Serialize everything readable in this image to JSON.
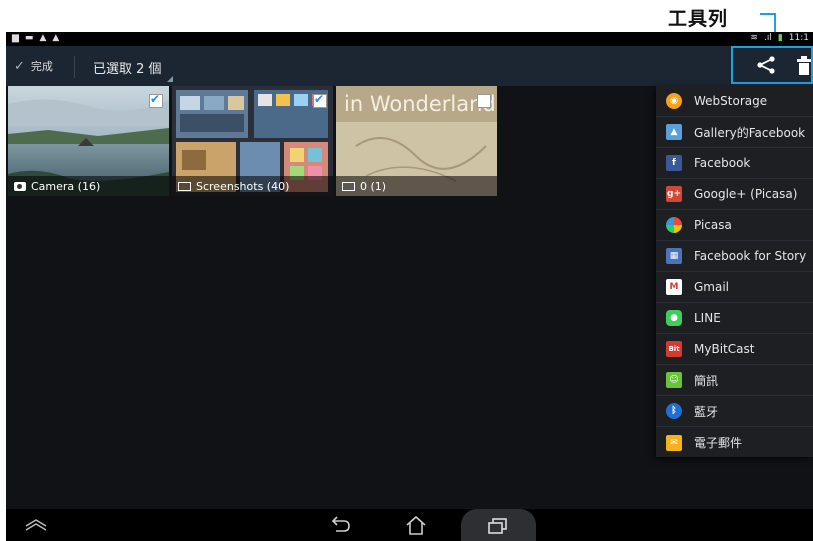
{
  "annotation": {
    "label": "工具列"
  },
  "status_bar": {
    "time": "11:1"
  },
  "action_bar": {
    "done_label": "完成",
    "selection_text": "已選取 2 個"
  },
  "albums": [
    {
      "name": "Camera (16)",
      "checked": true
    },
    {
      "name": "Screenshots (40)",
      "checked": true
    },
    {
      "name": "0 (1)",
      "checked": false,
      "thumb_text": "in Wonderland"
    }
  ],
  "share_menu": {
    "items": [
      {
        "label": "WebStorage",
        "icon": "webstorage-icon",
        "color": "#f7a21b"
      },
      {
        "label": "Gallery的Facebook",
        "icon": "gallery-icon",
        "color": "#5aa0d8"
      },
      {
        "label": "Facebook",
        "icon": "facebook-icon",
        "color": "#3b5998"
      },
      {
        "label": "Google+ (Picasa)",
        "icon": "googleplus-icon",
        "color": "#d14836"
      },
      {
        "label": "Picasa",
        "icon": "picasa-icon",
        "color": "#7a6fd6"
      },
      {
        "label": "Facebook for Story",
        "icon": "facebook-story-icon",
        "color": "#4b73b8"
      },
      {
        "label": "Gmail",
        "icon": "gmail-icon",
        "color": "#d23f31"
      },
      {
        "label": "LINE",
        "icon": "line-icon",
        "color": "#3ccf5a"
      },
      {
        "label": "MyBitCast",
        "icon": "mybitcast-icon",
        "color": "#d43a2f"
      },
      {
        "label": "簡訊",
        "icon": "messaging-icon",
        "color": "#6ac43b"
      },
      {
        "label": "藍牙",
        "icon": "bluetooth-icon",
        "color": "#1f6fd1"
      },
      {
        "label": "電子郵件",
        "icon": "email-icon",
        "color": "#f5b21a"
      }
    ]
  }
}
